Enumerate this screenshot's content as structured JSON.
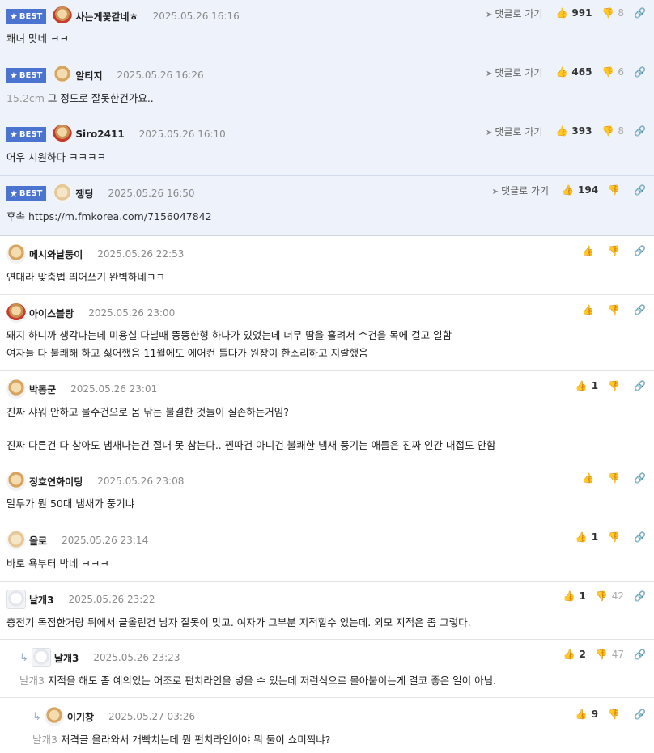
{
  "labels": {
    "best_badge": "BEST",
    "goto_reply": "댓글로 가기",
    "star": "★",
    "thumb_up": "👍",
    "thumb_down": "👎",
    "link": "🔗",
    "plane": "➤",
    "reply_arrow": "↳"
  },
  "comments": [
    {
      "nick": "사는게꽃같네ㅎ",
      "time": "2025.05.26 16:16",
      "up": "991",
      "down": "8",
      "text": "쾌녀 맞네 ㅋㅋ",
      "avatar": "dog-scarf-avatar"
    },
    {
      "nick": "알티지",
      "time": "2025.05.26 16:26",
      "up": "465",
      "down": "6",
      "mention": "15.2cm",
      "text": "그 정도로 잘못한건가요..",
      "avatar": "dog-avatar"
    },
    {
      "nick": "Siro2411",
      "time": "2025.05.26 16:10",
      "up": "393",
      "down": "8",
      "text": "어우 시원하다 ㅋㅋㅋㅋ",
      "avatar": "dog-scarf-avatar"
    },
    {
      "nick": "쟁딩",
      "time": "2025.05.26 16:50",
      "up": "194",
      "down": "",
      "text_prefix": "후속",
      "url": "https://m.fmkorea.com/7156047842",
      "avatar": "dog-pale-avatar"
    },
    {
      "nick": "메시와날둥이",
      "time": "2025.05.26 22:53",
      "up": "",
      "down": "",
      "text": "연대라 맞춤법 띄어쓰기 완벽하네ㅋㅋ",
      "avatar": "dog-avatar"
    },
    {
      "nick": "아이스블랑",
      "time": "2025.05.26 23:00",
      "up": "",
      "down": "",
      "text": "돼지 하니까 생각나는데 미용실 다닐때 뚱뚱한형 하나가 있었는데 너무 땀을 흘려서 수건을 목에 걸고 일함",
      "text2": "여자들 다 불쾌해 하고 싫어했음 11월에도 에어컨 틀다가 원장이 한소리하고 지랄했음",
      "avatar": "dog-scarf-avatar"
    },
    {
      "nick": "박동군",
      "time": "2025.05.26 23:01",
      "up": "1",
      "down": "",
      "text": "진짜 샤워 안하고 물수건으로 몸 닦는 불결한 것들이 실존하는거임?",
      "text2": "진짜 다른건 다 참아도 냄새나는건 절대 못 참는다.. 찐따건 아니건 불쾌한 냄새 풍기는 애들은 진짜 인간 대접도 안함",
      "avatar": "dog-avatar"
    },
    {
      "nick": "정호연화이팅",
      "time": "2025.05.26 23:08",
      "up": "",
      "down": "",
      "text": "말투가 뭔 50대 냄새가 풍기냐",
      "avatar": "dog-avatar"
    },
    {
      "nick": "올로",
      "time": "2025.05.26 23:14",
      "up": "1",
      "down": "",
      "text": "바로 욕부터 박네 ㅋㅋㅋ",
      "avatar": "dog-pale-avatar"
    },
    {
      "nick": "날개3",
      "time": "2025.05.26 23:22",
      "up": "1",
      "down": "42",
      "text": "충전기 독점한거랑 뒤에서 글올린건 남자 잘못이 맞고. 여자가 그부분 지적할수 있는데. 외모 지적은 좀 그렇다.",
      "avatar": "white-dog-avatar"
    },
    {
      "nick": "날개3",
      "time": "2025.05.26 23:23",
      "up": "2",
      "down": "47",
      "mention": "날개3",
      "text": "지적을 해도 좀 예의있는 어조로 펀치라인을 넣을 수 있는데 저런식으로 몰아붙이는게 결코 좋은 일이 아님.",
      "avatar": "white-dog-avatar"
    },
    {
      "nick": "이기창",
      "time": "2025.05.27 03:26",
      "up": "9",
      "down": "",
      "mention": "날개3",
      "text": "저격글 올라와서 개빡치는데 뭔 펀치라인이야 뭐 둘이 쇼미찍냐?",
      "avatar": "dog-avatar"
    }
  ]
}
